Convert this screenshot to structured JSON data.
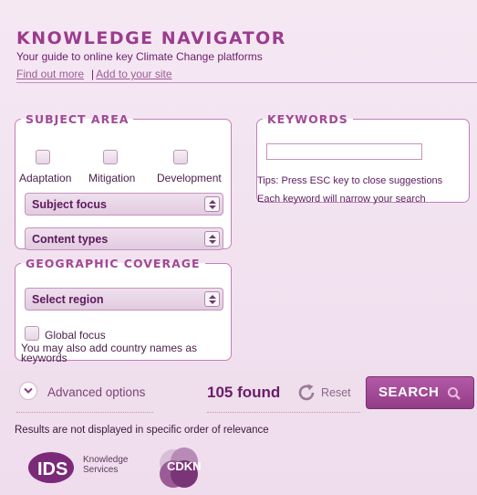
{
  "header": {
    "title": "KNOWLEDGE NAVIGATOR",
    "tagline": "Your guide to online key Climate Change platforms",
    "links": {
      "find_out_more": "Find out more",
      "separator": "|",
      "add_to_site": "Add to your site"
    }
  },
  "subject_area": {
    "legend": "SUBJECT AREA",
    "checkboxes": [
      {
        "label": "Adaptation",
        "checked": false
      },
      {
        "label": "Mitigation",
        "checked": false
      },
      {
        "label": "Development",
        "checked": false
      }
    ],
    "subject_focus": "Subject focus",
    "content_types": "Content types"
  },
  "geographic": {
    "legend": "GEOGRAPHIC COVERAGE",
    "region": "Select region",
    "global_focus": "Global focus",
    "note": "You may also add country names as keywords"
  },
  "keywords": {
    "legend": "KEYWORDS",
    "value": "",
    "tip1": "Tips: Press ESC key to close suggestions",
    "tip2": "Each keyword will narrow your search"
  },
  "actions": {
    "advanced": "Advanced options",
    "found": "105 found",
    "reset": "Reset",
    "search": "SEARCH"
  },
  "footer": {
    "results_note": "Results are not displayed in specific order of relevance",
    "ids_logo_text": "IDS",
    "ids_services": [
      "Knowledge",
      "Services"
    ],
    "cdkn_logo_text": "CDKN"
  },
  "colors": {
    "accent": "#9b3d8e",
    "button": "#a34a97",
    "background": "#f3e4f0"
  },
  "icons": [
    "chevron-down-icon",
    "reset-icon",
    "search-icon",
    "select-arrows-icon"
  ]
}
